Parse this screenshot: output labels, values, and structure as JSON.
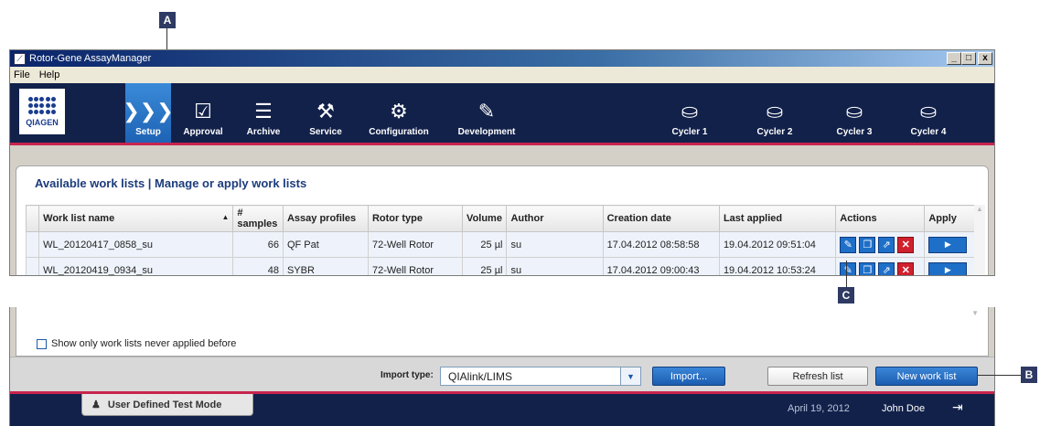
{
  "callouts": {
    "a": "A",
    "b": "B",
    "c": "C"
  },
  "window": {
    "title": "Rotor-Gene AssayManager",
    "app_icon": "rotor-gene-app-icon",
    "controls": {
      "minimize": "_",
      "maximize": "□",
      "close": "x"
    }
  },
  "menu": {
    "file": "File",
    "help": "Help"
  },
  "logo": {
    "name": "QIAGEN"
  },
  "nav": {
    "setup": {
      "label": "Setup",
      "icon": "chevrons-icon",
      "glyph": "❯❯❯"
    },
    "approval": {
      "label": "Approval",
      "icon": "approval-icon",
      "glyph": "☑"
    },
    "archive": {
      "label": "Archive",
      "icon": "archive-icon",
      "glyph": "☰"
    },
    "service": {
      "label": "Service",
      "icon": "tools-icon",
      "glyph": "⚒"
    },
    "configuration": {
      "label": "Configuration",
      "icon": "gears-icon",
      "glyph": "⚙"
    },
    "development": {
      "label": "Development",
      "icon": "development-icon",
      "glyph": "✎"
    },
    "cycler1": {
      "label": "Cycler 1",
      "icon": "cycler-icon",
      "glyph": "⛀"
    },
    "cycler2": {
      "label": "Cycler 2",
      "icon": "cycler-icon",
      "glyph": "⛀"
    },
    "cycler3": {
      "label": "Cycler 3",
      "icon": "cycler-icon",
      "glyph": "⛀"
    },
    "cycler4": {
      "label": "Cycler 4",
      "icon": "cycler-icon",
      "glyph": "⛀"
    }
  },
  "worklists": {
    "heading": "Available work lists | Manage or apply work lists",
    "columns": {
      "name": "Work list name",
      "samples": "# samples",
      "assay_profiles": "Assay profiles",
      "rotor_type": "Rotor type",
      "volume": "Volume",
      "author": "Author",
      "creation_date": "Creation date",
      "last_applied": "Last applied",
      "actions": "Actions",
      "apply": "Apply"
    },
    "rows": [
      {
        "name": "WL_20120417_0858_su",
        "samples": "66",
        "assay_profiles": "QF Pat",
        "rotor_type": "72-Well Rotor",
        "volume": "25 µl",
        "author": "su",
        "creation_date": "17.04.2012 08:58:58",
        "last_applied": "19.04.2012 09:51:04"
      },
      {
        "name": "WL_20120419_0934_su",
        "samples": "48",
        "assay_profiles": "SYBR",
        "rotor_type": "72-Well Rotor",
        "volume": "25 µl",
        "author": "su",
        "creation_date": "17.04.2012 09:00:43",
        "last_applied": "19.04.2012 10:53:24"
      }
    ]
  },
  "filter": {
    "never_applied_label": "Show only work lists never applied before"
  },
  "footer": {
    "import_type_label": "Import type:",
    "import_type_value": "QIAlink/LIMS",
    "import_button": "Import...",
    "refresh_button": "Refresh list",
    "new_button": "New work list"
  },
  "status": {
    "mode": "User Defined Test Mode",
    "date": "April 19, 2012",
    "user": "John Doe",
    "logout_icon": "logout-icon"
  }
}
